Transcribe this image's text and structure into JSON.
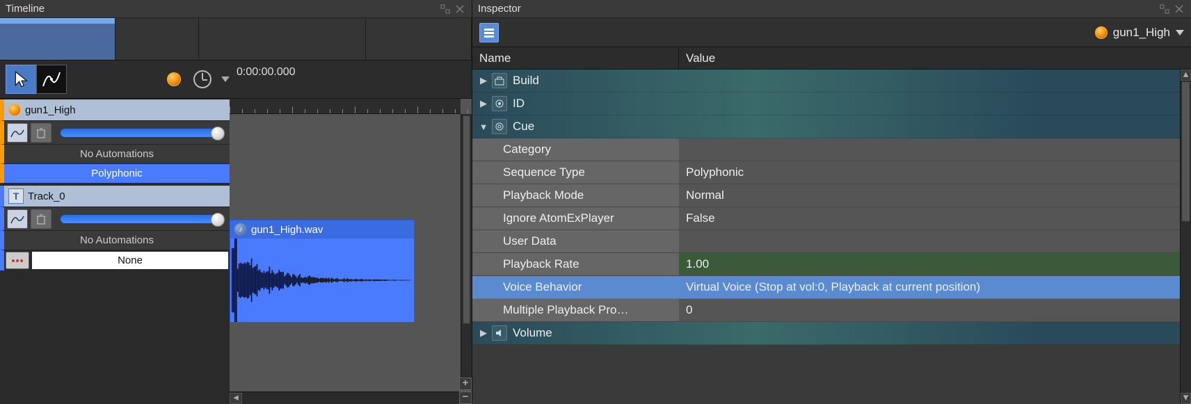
{
  "timeline": {
    "title": "Timeline",
    "timecode": "0:00:00.000",
    "cue": {
      "name": "gun1_High",
      "automations": "No Automations",
      "sequence": "Polyphonic"
    },
    "track": {
      "name": "Track_0",
      "automations": "No Automations",
      "effect": "None",
      "clip_file": "gun1_High.wav"
    }
  },
  "inspector": {
    "title": "Inspector",
    "object": "gun1_High",
    "columns": {
      "name": "Name",
      "value": "Value"
    },
    "groups": {
      "build": "Build",
      "id": "ID",
      "cue": "Cue",
      "volume": "Volume"
    },
    "props": {
      "category": {
        "label": "Category",
        "value": ""
      },
      "sequence_type": {
        "label": "Sequence Type",
        "value": "Polyphonic"
      },
      "playback_mode": {
        "label": "Playback Mode",
        "value": "Normal"
      },
      "ignore_atom": {
        "label": "Ignore AtomExPlayer",
        "value": "False"
      },
      "user_data": {
        "label": "User Data",
        "value": ""
      },
      "playback_rate": {
        "label": "Playback Rate",
        "value": "1.00"
      },
      "voice_behavior": {
        "label": "Voice Behavior",
        "value": "Virtual Voice (Stop at vol:0, Playback at current position)"
      },
      "multi_playback": {
        "label": "Multiple Playback Pro…",
        "value": "0"
      }
    }
  }
}
